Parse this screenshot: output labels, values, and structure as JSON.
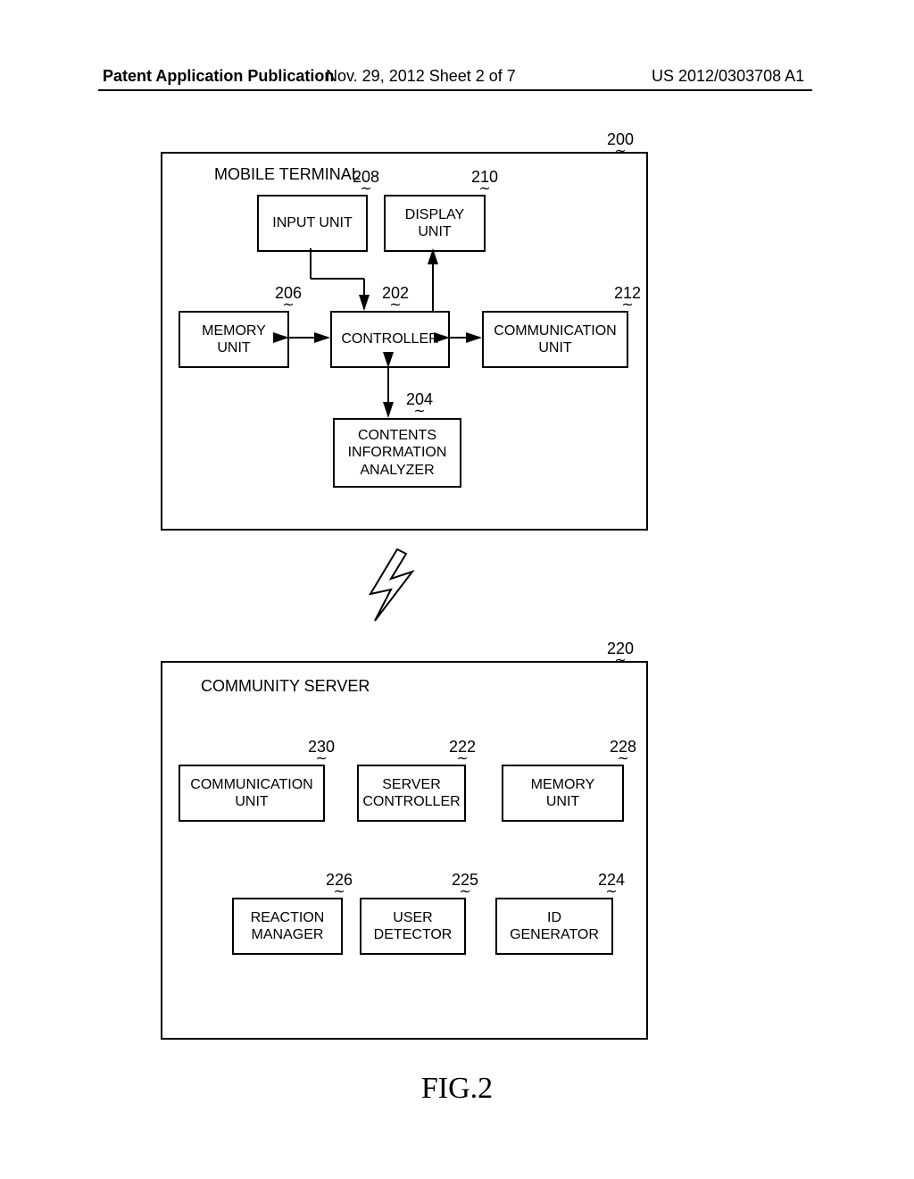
{
  "header": {
    "left": "Patent Application Publication",
    "mid": "Nov. 29, 2012  Sheet 2 of 7",
    "right": "US 2012/0303708 A1"
  },
  "mobile": {
    "title": "MOBILE TERMINAL",
    "ref": "200",
    "input_unit": {
      "label": "INPUT UNIT",
      "ref": "208"
    },
    "display_unit": {
      "label_line1": "DISPLAY",
      "label_line2": "UNIT",
      "ref": "210"
    },
    "memory_unit": {
      "label_line1": "MEMORY",
      "label_line2": "UNIT",
      "ref": "206"
    },
    "controller": {
      "label": "CONTROLLER",
      "ref": "202"
    },
    "communication_unit": {
      "label_line1": "COMMUNICATION",
      "label_line2": "UNIT",
      "ref": "212"
    },
    "analyzer": {
      "label_line1": "CONTENTS",
      "label_line2": "INFORMATION",
      "label_line3": "ANALYZER",
      "ref": "204"
    }
  },
  "server": {
    "title": "COMMUNITY SERVER",
    "ref": "220",
    "communication_unit": {
      "label_line1": "COMMUNICATION",
      "label_line2": "UNIT",
      "ref": "230"
    },
    "controller": {
      "label_line1": "SERVER",
      "label_line2": "CONTROLLER",
      "ref": "222"
    },
    "memory_unit": {
      "label_line1": "MEMORY",
      "label_line2": "UNIT",
      "ref": "228"
    },
    "reaction_manager": {
      "label_line1": "REACTION",
      "label_line2": "MANAGER",
      "ref": "226"
    },
    "user_detector": {
      "label_line1": "USER",
      "label_line2": "DETECTOR",
      "ref": "225"
    },
    "id_generator": {
      "label_line1": "ID",
      "label_line2": "GENERATOR",
      "ref": "224"
    }
  },
  "figure_caption": "FIG.2"
}
